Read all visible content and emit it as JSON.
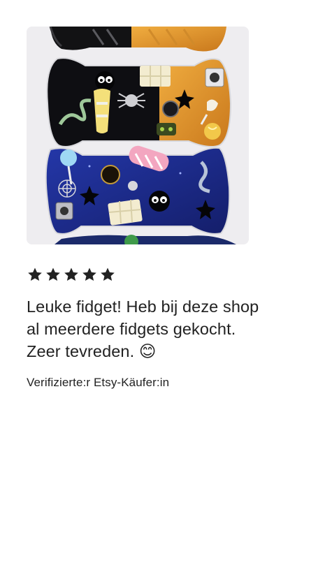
{
  "review": {
    "rating": 5,
    "rating_max": 5,
    "text": "Leuke fidget! Heb bij deze shop al meerdere fidgets gekocht. Zeer tevreden. 😊",
    "reviewer": "Verifizierte:r Etsy-Käufer:in"
  },
  "photo": {
    "subject": "halloween candy-shaped resin fidgets",
    "colors": {
      "background": "#f1f0f2",
      "resin_black": "#101014",
      "resin_orange": "#e79a2c",
      "resin_blue": "#1d2c8f",
      "accent_white": "#efe9d6"
    }
  },
  "colors": {
    "star": "#222222",
    "text": "#222222",
    "page_bg": "#ffffff"
  }
}
